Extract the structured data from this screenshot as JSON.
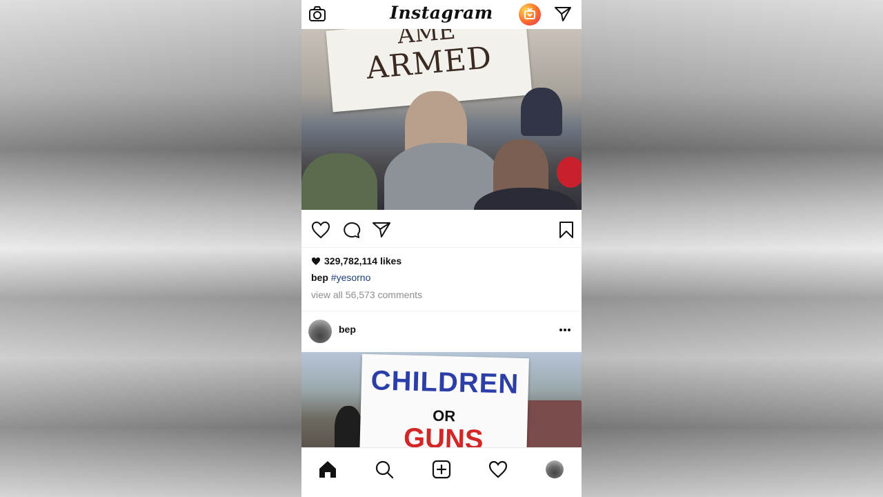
{
  "app": {
    "title": "Instagram"
  },
  "icons": {
    "camera": "camera-icon",
    "igtv": "igtv-icon",
    "direct": "direct-message-icon",
    "like": "heart-icon",
    "comment": "comment-icon",
    "share": "share-icon",
    "save": "bookmark-icon",
    "more": "more-icon",
    "home": "home-icon",
    "search": "search-icon",
    "add": "add-post-icon",
    "activity": "heart-icon",
    "profile": "profile-avatar"
  },
  "post1": {
    "image_sign_top": "AME",
    "image_sign_main": "ARMED",
    "likes": "329,782,114 likes",
    "caption_user": "bep",
    "caption_hashtag": "#yesorno",
    "view_comments": "view all 56,573 comments"
  },
  "post2": {
    "username": "bep",
    "sign_line1": "CHILDREN",
    "sign_line2": "OR",
    "sign_line3": "GUNS"
  },
  "colors": {
    "hashtag": "#1d3f7a",
    "muted": "#8e8e8e",
    "igtv_gradient_start": "#ffd34e",
    "igtv_gradient_end": "#e1306c"
  }
}
